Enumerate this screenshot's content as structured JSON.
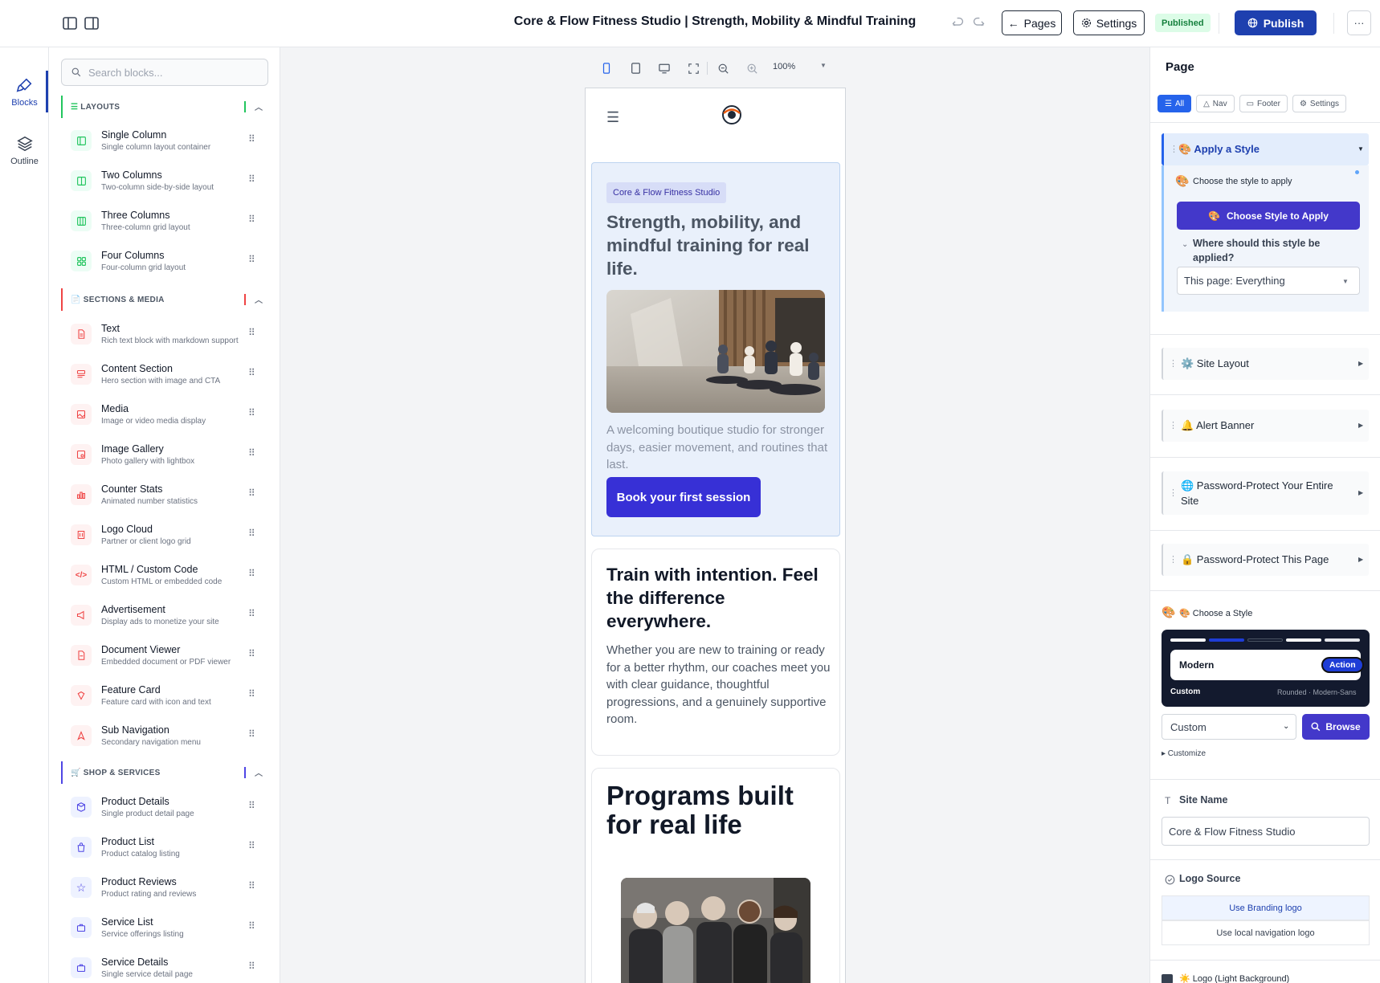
{
  "header": {
    "title": "Core & Flow Fitness Studio | Strength, Mobility & Mindful Training",
    "pages_label": "Pages",
    "settings_label": "Settings",
    "status_badge": "Published",
    "publish_label": "Publish",
    "more_label": "···"
  },
  "rail": {
    "blocks_label": "Blocks",
    "outline_label": "Outline"
  },
  "blocks_panel": {
    "search_placeholder": "Search blocks...",
    "sections": [
      {
        "title": "LAYOUTS",
        "icon": "layout-icon",
        "accent": "#22c55e",
        "items": [
          {
            "name": "Single Column",
            "desc": "Single column layout container"
          },
          {
            "name": "Two Columns",
            "desc": "Two-column side-by-side layout"
          },
          {
            "name": "Three Columns",
            "desc": "Three-column grid layout"
          },
          {
            "name": "Four Columns",
            "desc": "Four-column grid layout"
          }
        ]
      },
      {
        "title": "SECTIONS & MEDIA",
        "icon": "page-icon",
        "accent": "#ef4444",
        "items": [
          {
            "name": "Text",
            "desc": "Rich text block with markdown support"
          },
          {
            "name": "Content Section",
            "desc": "Hero section with image and CTA"
          },
          {
            "name": "Media",
            "desc": "Image or video media display"
          },
          {
            "name": "Image Gallery",
            "desc": "Photo gallery with lightbox"
          },
          {
            "name": "Counter Stats",
            "desc": "Animated number statistics"
          },
          {
            "name": "Logo Cloud",
            "desc": "Partner or client logo grid"
          },
          {
            "name": "HTML / Custom Code",
            "desc": "Custom HTML or embedded code"
          },
          {
            "name": "Advertisement",
            "desc": "Display ads to monetize your site"
          },
          {
            "name": "Document Viewer",
            "desc": "Embedded document or PDF viewer"
          },
          {
            "name": "Feature Card",
            "desc": "Feature card with icon and text"
          },
          {
            "name": "Sub Navigation",
            "desc": "Secondary navigation menu"
          }
        ]
      },
      {
        "title": "SHOP & SERVICES",
        "icon": "cart-icon",
        "accent": "#4f46e5",
        "items": [
          {
            "name": "Product Details",
            "desc": "Single product detail page"
          },
          {
            "name": "Product List",
            "desc": "Product catalog listing"
          },
          {
            "name": "Product Reviews",
            "desc": "Product rating and reviews"
          },
          {
            "name": "Service List",
            "desc": "Service offerings listing"
          },
          {
            "name": "Service Details",
            "desc": "Single service detail page"
          }
        ]
      }
    ]
  },
  "canvas": {
    "zoom": "100%",
    "hero": {
      "badge": "Core & Flow Fitness Studio",
      "heading": "Strength, mobility, and mindful training for real life.",
      "paragraph": "A welcoming boutique studio for stronger days, easier movement, and routines that last.",
      "cta": "Book your first session"
    },
    "card1": {
      "heading": "Train with intention. Feel the difference everywhere.",
      "paragraph": "Whether you are new to training or ready for a better rhythm, our coaches meet you with clear guidance, thoughtful progressions, and a genuinely supportive room."
    },
    "card2": {
      "heading": "Programs built for real life"
    }
  },
  "right_panel": {
    "title": "Page",
    "tabs": [
      "All",
      "Nav",
      "Footer",
      "Settings"
    ],
    "apply_style": {
      "title": "🎨 Apply a Style",
      "choose_label": "Choose the style to apply",
      "choose_button": "Choose Style to Apply",
      "where_label": "Where should this style be applied?",
      "scope_value": "This page: Everything"
    },
    "accordions": [
      "⚙️ Site Layout",
      "🔔 Alert Banner",
      "🌐 Password-Protect Your Entire Site",
      "🔒 Password-Protect This Page"
    ],
    "choose_style": {
      "label": "🎨 Choose a Style",
      "preview_name": "Modern",
      "preview_action": "Action",
      "preview_footer_left": "Custom",
      "preview_footer_right": "Rounded · Modern-Sans",
      "select_value": "Custom",
      "browse_label": "Browse",
      "customize_label": "▸ Customize"
    },
    "site_name": {
      "label": "Site Name",
      "value": "Core & Flow Fitness Studio"
    },
    "logo_source": {
      "label": "Logo Source",
      "option_active": "Use Branding logo",
      "option_other": "Use local navigation logo"
    },
    "logo_light": {
      "label": "☀️ Logo (Light Background)"
    }
  },
  "colors": {
    "primary": "#1e40af",
    "cta": "#3730d6",
    "accent_blue": "#2563eb",
    "style_dark": "#131a2e"
  }
}
